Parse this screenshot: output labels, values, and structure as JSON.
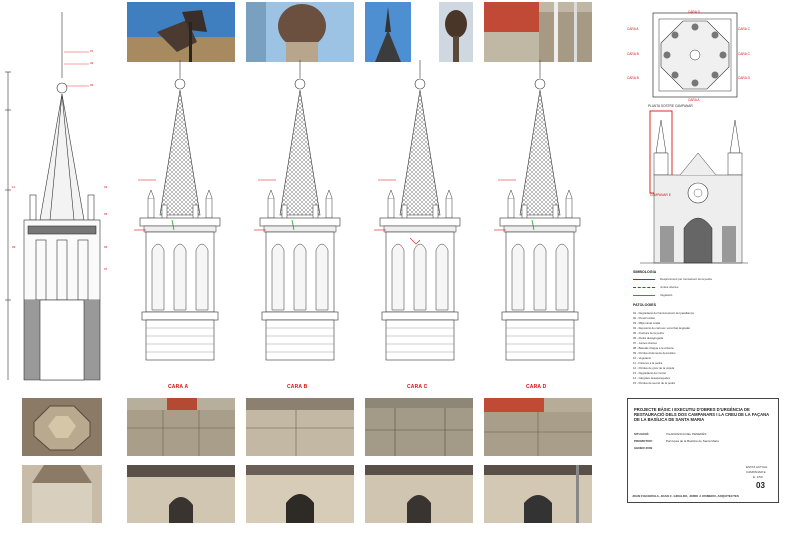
{
  "faces": {
    "a": "CARA A",
    "b": "CARA B",
    "c": "CARA C",
    "d": "CARA D"
  },
  "plan": {
    "caption": "PLANTA SOSTRE CAMPANAR",
    "labels": [
      "CARA D",
      "CARA A",
      "CARA C",
      "CARA B",
      "CARA C",
      "CARA B",
      "CARA D",
      "CARA A"
    ]
  },
  "facade": {
    "caption": "CAMPANAR E"
  },
  "legend": {
    "simbologia_title": "SIMBOLOGIA",
    "simbologia": [
      "Despreniment per trencament de la pedra",
      "Juntes obertes",
      "Vegetació"
    ],
    "patologies_title": "PATOLOGIES",
    "patologies": [
      "01 - Degradació del funcionament del parallamps",
      "02 - Penell oxidat",
      "03 - Mitjà canal oxidat",
      "04 - Reposició de carreus i encorbat degradat",
      "05 - Fractura de la pedra",
      "06 - Pedra desagregada",
      "07 - Juntes obertes",
      "08 - Bassals d'aigua a la coberta",
      "09 - Pèrdua d'elements decoratius",
      "10 - Vegetació",
      "11 - Fissures a la pedra",
      "12 - Pèrdua de gruix de la cúpula",
      "13 - Degradació del morter",
      "14 - Gàrgoles desaparegudes",
      "15 - Pèrdua de secció de la pedra"
    ]
  },
  "callouts": [
    "01",
    "02",
    "03",
    "04",
    "05",
    "06",
    "07",
    "08",
    "09",
    "10",
    "11",
    "12"
  ],
  "titleblock": {
    "title": "PROJECTE BÀSIC I EXECUTIU D'OBRES D'URGÈNCIA DE RESTAURACIÓ DELS DOS CAMPANARS I LA CREU DE LA FAÇANA DE LA BASÍLICA DE SANTA MARIA",
    "situacio_label": "SITUACIÓ:",
    "situacio": "VILAFRANCA DEL PENEDÈS",
    "promotor_label": "PROMOTOR:",
    "promotor": "Parròquia de la Basílica de Santa Maria",
    "date": "GENER 2009",
    "sheet_desc": "ESTAT ACTUAL",
    "sheet_sub": "CAMPANAR E",
    "scale": "E: 1/50",
    "number": "03",
    "authors": "JOAN FIGUEROLA, JOAN C. GIRALDO, JORDI J. ROMERO, ARQUITECTES"
  },
  "colors": {
    "red": "#dd1111",
    "line": "#333333",
    "green": "#2a9d2a"
  }
}
